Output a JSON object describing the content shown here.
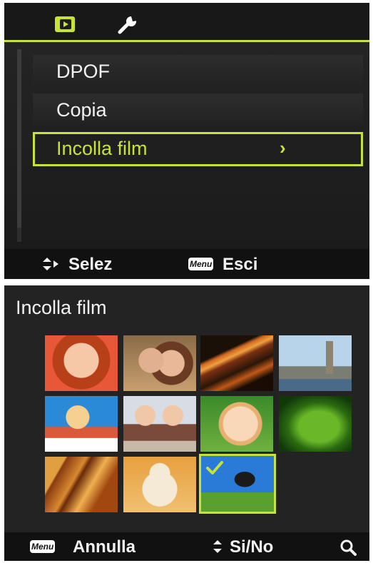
{
  "menu_screen": {
    "tabs": [
      {
        "icon": "playback-icon",
        "active": true
      },
      {
        "icon": "wrench-icon",
        "active": false
      }
    ],
    "items": [
      {
        "label": "DPOF"
      },
      {
        "label": "Copia"
      },
      {
        "label": "Incolla film",
        "arrow": "›",
        "selected": true
      }
    ],
    "footer": {
      "select_label": "Selez",
      "menu_badge": "Menu",
      "exit_label": "Esci"
    }
  },
  "paste_screen": {
    "title": "Incolla film",
    "thumbnails": [
      {
        "subject": "woman-portrait"
      },
      {
        "subject": "couple-portrait"
      },
      {
        "subject": "night-light-trails"
      },
      {
        "subject": "big-ben-london"
      },
      {
        "subject": "mother-child-sky"
      },
      {
        "subject": "two-children"
      },
      {
        "subject": "toddler-green"
      },
      {
        "subject": "green-leaf"
      },
      {
        "subject": "playground-slide"
      },
      {
        "subject": "teddy-bear"
      },
      {
        "subject": "jumping-child",
        "selected": true
      }
    ],
    "footer": {
      "menu_badge": "Menu",
      "cancel_label": "Annulla",
      "toggle_label": "Si/No"
    }
  },
  "colors": {
    "accent": "#c6e33a",
    "background": "#1d1d1d",
    "bar": "#111111",
    "text": "#f2f2f2"
  }
}
